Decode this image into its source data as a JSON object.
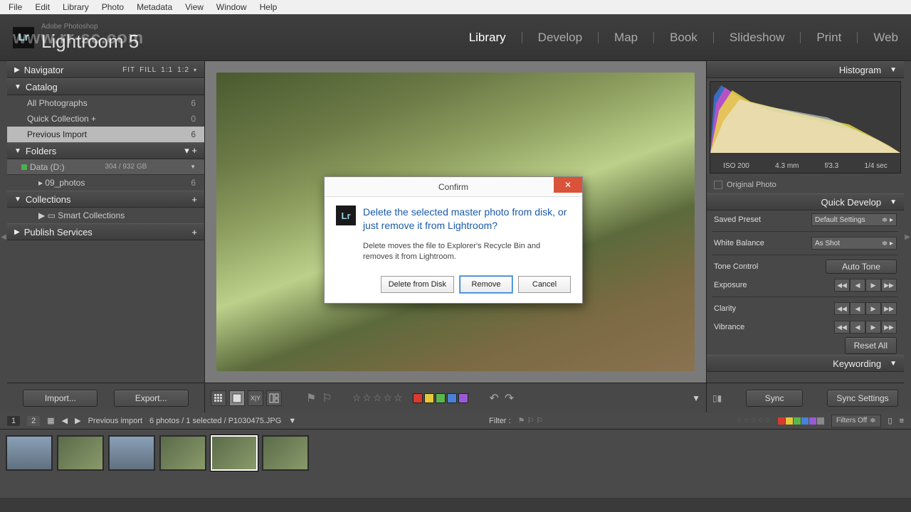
{
  "menu": {
    "file": "File",
    "edit": "Edit",
    "library": "Library",
    "photo": "Photo",
    "metadata": "Metadata",
    "view": "View",
    "window": "Window",
    "help": "Help"
  },
  "brand": {
    "sub": "Adobe Photoshop",
    "main": "Lightroom 5"
  },
  "modules": {
    "library": "Library",
    "develop": "Develop",
    "map": "Map",
    "book": "Book",
    "slideshow": "Slideshow",
    "print": "Print",
    "web": "Web"
  },
  "leftpanel": {
    "navigator": "Navigator",
    "navopts": [
      "FIT",
      "FILL",
      "1:1",
      "1:2"
    ],
    "catalog": "Catalog",
    "cat_items": [
      {
        "l": "All Photographs",
        "n": "6"
      },
      {
        "l": "Quick Collection  +",
        "n": "0"
      },
      {
        "l": "Previous Import",
        "n": "6"
      }
    ],
    "folders": "Folders",
    "disk": {
      "name": "Data (D:)",
      "info": "304 / 932 GB"
    },
    "folder_items": [
      {
        "l": "09_photos",
        "n": "6"
      }
    ],
    "collections": "Collections",
    "smart": "Smart Collections",
    "publish": "Publish Services",
    "import": "Import...",
    "export": "Export..."
  },
  "rightpanel": {
    "histogram": "Histogram",
    "hist": {
      "iso": "ISO 200",
      "fl": "4.3 mm",
      "ap": "f/3.3",
      "sh": "1/4 sec"
    },
    "original": "Original Photo",
    "quickdev": "Quick Develop",
    "saved": "Saved Preset",
    "saved_v": "Default Settings",
    "wb": "White Balance",
    "wb_v": "As Shot",
    "tone": "Tone Control",
    "auto": "Auto Tone",
    "exposure": "Exposure",
    "clarity": "Clarity",
    "vibrance": "Vibrance",
    "reset": "Reset All",
    "keywording": "Keywording",
    "sync": "Sync",
    "syncset": "Sync Settings"
  },
  "filmstrip": {
    "p1": "1",
    "p2": "2",
    "src": "Previous import",
    "info": "6 photos / 1 selected / P1030475.JPG",
    "filter": "Filter :",
    "filters_off": "Filters Off"
  },
  "dialog": {
    "title": "Confirm",
    "q": "Delete the selected master photo from disk, or just remove it from Lightroom?",
    "d": "Delete moves the file to Explorer's Recycle Bin and removes it from Lightroom.",
    "b1": "Delete from Disk",
    "b2": "Remove",
    "b3": "Cancel"
  },
  "colors": {
    "red": "#d83a2e",
    "yel": "#e4c83a",
    "grn": "#5ab64b",
    "blu": "#4a80d8",
    "pur": "#9a5ad6"
  },
  "wm": "www.rr-sc.com"
}
